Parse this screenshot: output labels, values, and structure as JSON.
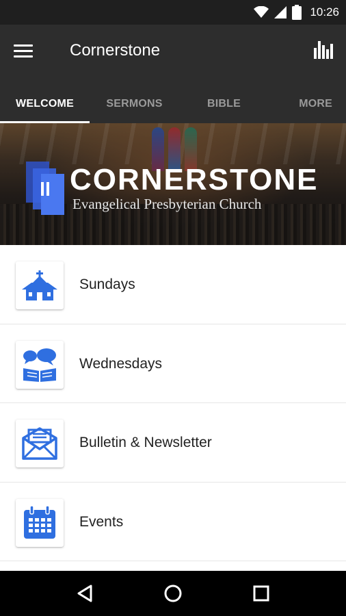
{
  "status_bar": {
    "time": "10:26",
    "icons": [
      "wifi-icon",
      "signal-icon",
      "battery-icon"
    ]
  },
  "app_bar": {
    "title": "Cornerstone",
    "menu_icon": "hamburger-menu-icon",
    "action_icon": "bar-chart-icon"
  },
  "tabs": [
    {
      "label": "WELCOME",
      "active": true
    },
    {
      "label": "SERMONS",
      "active": false
    },
    {
      "label": "BIBLE",
      "active": false
    },
    {
      "label": "MORE",
      "active": false
    }
  ],
  "hero": {
    "title": "CORNERSTONE",
    "subtitle": "Evangelical Presbyterian Church"
  },
  "list": [
    {
      "label": "Sundays",
      "icon": "church-icon"
    },
    {
      "label": "Wednesdays",
      "icon": "bible-study-icon"
    },
    {
      "label": "Bulletin & Newsletter",
      "icon": "envelope-icon"
    },
    {
      "label": "Events",
      "icon": "calendar-icon"
    }
  ],
  "nav_bar": {
    "icons": [
      "back-icon",
      "home-icon",
      "recents-icon"
    ]
  },
  "colors": {
    "accent": "#2f6fe0",
    "app_bar": "#2d2d2d",
    "status_bar": "#1f1f1f"
  }
}
